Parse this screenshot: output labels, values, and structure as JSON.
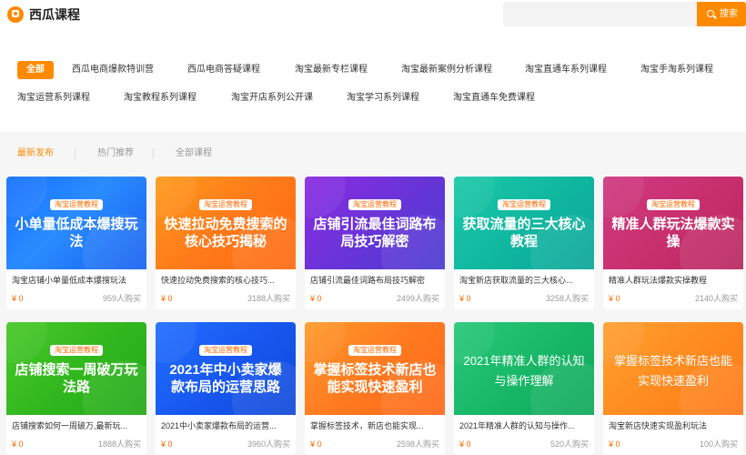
{
  "header": {
    "logo_text": "西瓜课程",
    "search_placeholder": "",
    "search_label": "搜索"
  },
  "categories": [
    {
      "label": "全部",
      "active": true
    },
    {
      "label": "西瓜电商爆款特训营"
    },
    {
      "label": "西瓜电商答疑课程"
    },
    {
      "label": "淘宝最新专栏课程"
    },
    {
      "label": "淘宝最新案例分析课程"
    },
    {
      "label": "淘宝直通车系列课程"
    },
    {
      "label": "淘宝手淘系列课程"
    },
    {
      "label": "淘宝运营系列课程"
    },
    {
      "label": "淘宝教程系列课程"
    },
    {
      "label": "淘宝开店系列公开课"
    },
    {
      "label": "淘宝学习系列课程"
    },
    {
      "label": "淘宝直通车免费课程"
    }
  ],
  "subtabs": [
    "最新发布",
    "热门推荐",
    "全部课程"
  ],
  "courses": [
    {
      "tag": "淘宝运营教程",
      "thumb_title": "小单量低成本爆搜玩法",
      "title": "淘宝店铺小单量低成本爆搜玩法",
      "price": "¥ 0",
      "buyers": "959人购买"
    },
    {
      "tag": "淘宝运营教程",
      "thumb_title": "快速拉动免费搜索的核心技巧揭秘",
      "title": "快速拉动免费搜索的核心技巧...",
      "price": "¥ 0",
      "buyers": "3188人购买"
    },
    {
      "tag": "淘宝运营教程",
      "thumb_title": "店铺引流最佳词路布局技巧解密",
      "title": "店铺引流最佳词路布局技巧解密",
      "price": "¥ 0",
      "buyers": "2499人购买"
    },
    {
      "tag": "淘宝运营教程",
      "thumb_title": "获取流量的三大核心教程",
      "title": "淘宝新店获取流量的三大核心...",
      "price": "¥ 0",
      "buyers": "3258人购买"
    },
    {
      "tag": "淘宝运营教程",
      "thumb_title": "精准人群玩法爆款实操",
      "title": "精准人群玩法爆款实操教程",
      "price": "¥ 0",
      "buyers": "2140人购买"
    },
    {
      "tag": "淘宝运营教程",
      "thumb_title": "店铺搜索一周破万玩法路",
      "title": "店铺搜索如何一周破万,最新玩...",
      "price": "¥ 0",
      "buyers": "1888人购买"
    },
    {
      "tag": "淘宝运营教程",
      "thumb_title": "2021年中小卖家爆款布局的运营思路",
      "title": "2021中小卖家爆款布局的运营...",
      "price": "¥ 0",
      "buyers": "3960人购买"
    },
    {
      "tag": "淘宝运营教程",
      "thumb_title": "掌握标签技术新店也能实现快速盈利",
      "title": "掌握标签技术，新店也能实现...",
      "price": "¥ 0",
      "buyers": "2598人购买"
    },
    {
      "tag": "",
      "thumb_title": "2021年精准人群的认知与操作理解",
      "title": "2021年精准人群的认知与操作...",
      "price": "¥ 0",
      "buyers": "520人购买"
    },
    {
      "tag": "",
      "thumb_title": "掌握标签技术新店也能实现快速盈利",
      "title": "淘宝新店快速实现盈利玩法",
      "price": "¥ 0",
      "buyers": "100人购买"
    }
  ]
}
